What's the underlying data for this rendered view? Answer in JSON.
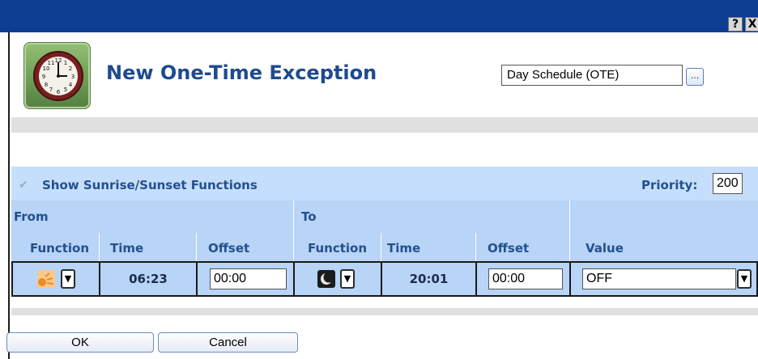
{
  "window": {
    "help_label": "?",
    "close_label": "X"
  },
  "header": {
    "title": "New One-Time Exception",
    "schedule_value": "Day Schedule (OTE)",
    "browse_label": "..."
  },
  "options": {
    "show_sunrise_sunset_label": "Show Sunrise/Sunset Functions",
    "show_sunrise_sunset_checked": true,
    "priority_label": "Priority:",
    "priority_value": "200"
  },
  "table": {
    "from_label": "From",
    "to_label": "To",
    "columns": [
      "Function",
      "Time",
      "Offset",
      "Function",
      "Time",
      "Offset",
      "Value"
    ],
    "row": {
      "from_function_icon": "sunrise-icon",
      "from_time": "06:23",
      "from_offset": "00:00",
      "to_function_icon": "moon-icon",
      "to_time": "20:01",
      "to_offset": "00:00",
      "value": "OFF"
    }
  },
  "footer": {
    "ok_label": "OK",
    "cancel_label": "Cancel"
  },
  "colors": {
    "titlebar": "#0b3d91",
    "header_text": "#1e4a8f",
    "label_text": "#23508f",
    "table_bg": "#b8d4f6"
  }
}
